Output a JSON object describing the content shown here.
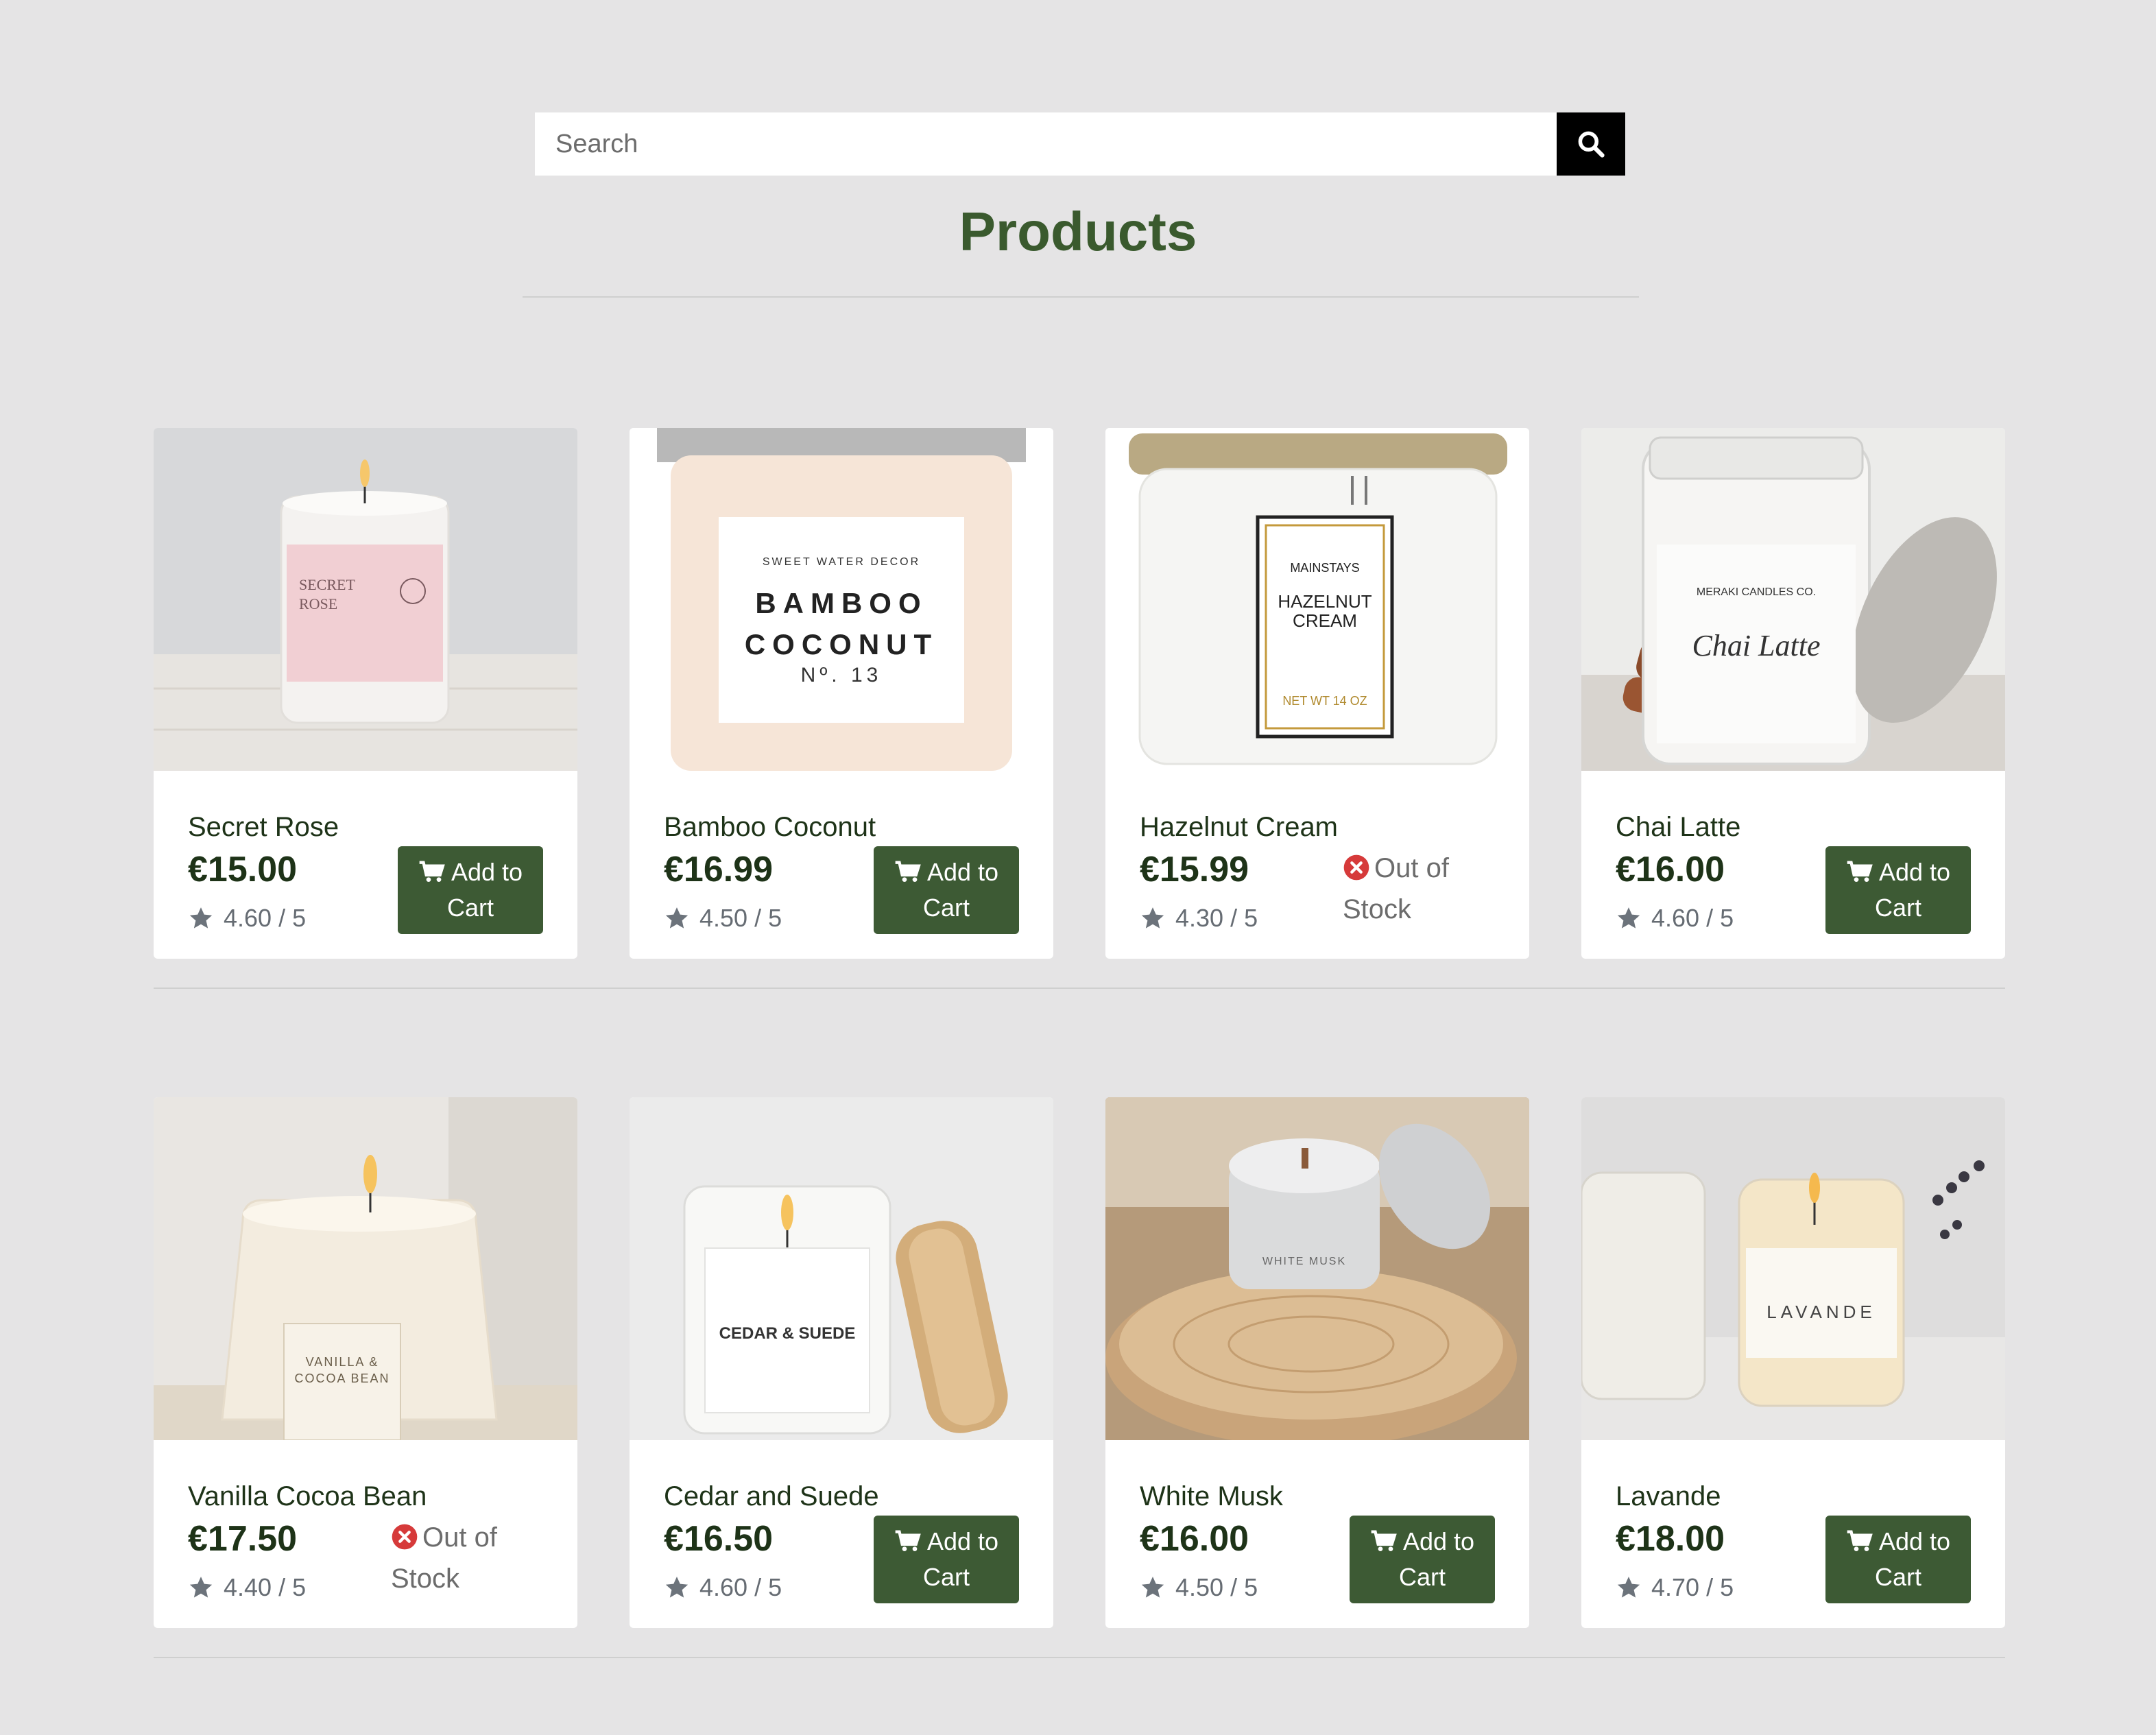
{
  "search": {
    "placeholder": "Search"
  },
  "page_title": "Products",
  "colors": {
    "background": "#e5e4e5",
    "accent": "#3d5a34",
    "title": "#3a5a2e",
    "out_of_stock_icon": "#d63a3a"
  },
  "products": [
    {
      "name": "Secret Rose",
      "price": "€15.00",
      "rating": "4.60 / 5",
      "action_line1": "Add to",
      "action_line2": "Cart",
      "in_stock": true
    },
    {
      "name": "Bamboo Coconut",
      "price": "€16.99",
      "rating": "4.50 / 5",
      "action_line1": "Add to",
      "action_line2": "Cart",
      "in_stock": true
    },
    {
      "name": "Hazelnut Cream",
      "price": "€15.99",
      "rating": "4.30 / 5",
      "status_line1": "Out of",
      "status_line2": "Stock",
      "in_stock": false
    },
    {
      "name": "Chai Latte",
      "price": "€16.00",
      "rating": "4.60 / 5",
      "action_line1": "Add to",
      "action_line2": "Cart",
      "in_stock": true
    },
    {
      "name": "Vanilla Cocoa Bean",
      "price": "€17.50",
      "rating": "4.40 / 5",
      "status_line1": "Out of",
      "status_line2": "Stock",
      "in_stock": false
    },
    {
      "name": "Cedar and Suede",
      "price": "€16.50",
      "rating": "4.60 / 5",
      "action_line1": "Add to",
      "action_line2": "Cart",
      "in_stock": true
    },
    {
      "name": "White Musk",
      "price": "€16.00",
      "rating": "4.50 / 5",
      "action_line1": "Add to",
      "action_line2": "Cart",
      "in_stock": true
    },
    {
      "name": "Lavande",
      "price": "€18.00",
      "rating": "4.70 / 5",
      "action_line1": "Add to",
      "action_line2": "Cart",
      "in_stock": true
    }
  ],
  "labels": {
    "secret_rose": [
      "SECRET",
      "ROSE"
    ],
    "bamboo_coconut": [
      "SWEET WATER DECOR",
      "BAMBOO",
      "COCONUT",
      "Nº. 13"
    ],
    "hazelnut_cream": [
      "MAINSTAYS",
      "HAZELNUT",
      "CREAM",
      "NET WT 14 OZ"
    ],
    "chai_latte": [
      "MERAKI CANDLES CO.",
      "Chai Latte"
    ],
    "vanilla_cocoa": [
      "VANILLA &",
      "COCOA BEAN"
    ],
    "cedar_suede": [
      "CEDAR & SUEDE"
    ],
    "white_musk": [
      "WHITE MUSK"
    ],
    "lavande": [
      "LAVANDE"
    ]
  }
}
